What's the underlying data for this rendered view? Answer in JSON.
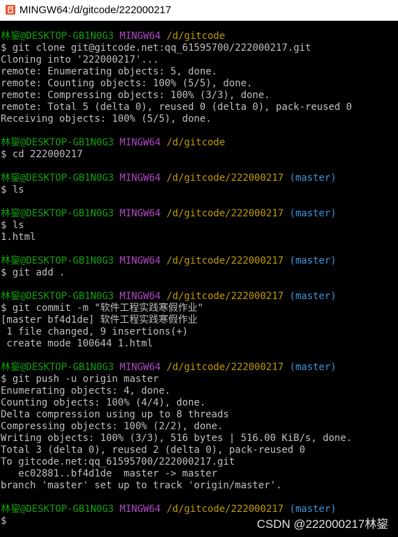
{
  "window": {
    "title": "MINGW64:/d/gitcode/222000217",
    "icon": "git-bash-icon"
  },
  "colors": {
    "user": "#13a10e",
    "shell": "#b148c6",
    "path": "#c19c00",
    "branch": "#3a96dd",
    "text": "#c0c0c0"
  },
  "prompt": {
    "user": "林鋆@DESKTOP-GB1N0G3",
    "shell": "MINGW64",
    "path_root": "/d/gitcode",
    "path_repo": "/d/gitcode/222000217",
    "branch": "(master)",
    "dollar": "$"
  },
  "commands": {
    "clone": " git clone git@gitcode.net:qq_61595700/222000217.git",
    "cd": " cd 222000217",
    "ls1": " ls",
    "ls2": " ls",
    "add": " git add .",
    "commit": " git commit -m \"软件工程实践寒假作业\"",
    "push": " git push -u origin master",
    "last": " "
  },
  "output": {
    "clone": [
      "Cloning into '222000217'...",
      "remote: Enumerating objects: 5, done.",
      "remote: Counting objects: 100% (5/5), done.",
      "remote: Compressing objects: 100% (3/3), done.",
      "remote: Total 5 (delta 0), reused 0 (delta 0), pack-reused 0",
      "Receiving objects: 100% (5/5), done."
    ],
    "ls2": [
      "1.html"
    ],
    "commit": [
      "[master bf4d1de] 软件工程实践寒假作业",
      " 1 file changed, 9 insertions(+)",
      " create mode 100644 1.html"
    ],
    "push": [
      "Enumerating objects: 4, done.",
      "Counting objects: 100% (4/4), done.",
      "Delta compression using up to 8 threads",
      "Compressing objects: 100% (2/2), done.",
      "Writing objects: 100% (3/3), 516 bytes | 516.00 KiB/s, done.",
      "Total 3 (delta 0), reused 2 (delta 0), pack-reused 0",
      "To gitcode.net:qq_61595700/222000217.git",
      "   ec02881..bf4d1de  master -> master",
      "branch 'master' set up to track 'origin/master'."
    ]
  },
  "watermark": "CSDN @222000217林鋆"
}
